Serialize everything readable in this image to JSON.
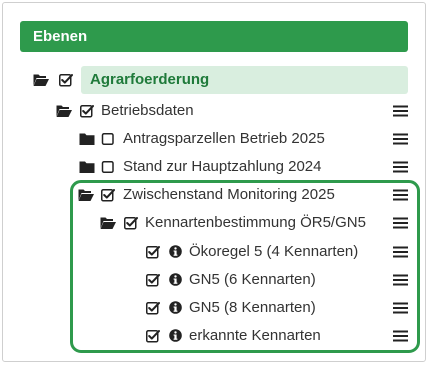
{
  "panel": {
    "title": "Ebenen"
  },
  "tree": {
    "root": {
      "label": "Agrarfoerderung"
    },
    "betriebsdaten": {
      "label": "Betriebsdaten"
    },
    "antragsparzellen": {
      "label": "Antragsparzellen Betrieb 2025"
    },
    "stand": {
      "label": "Stand zur Hauptzahlung 2024"
    },
    "zwischenstand": {
      "label": "Zwischenstand Monitoring 2025"
    },
    "kennartenbestimmung": {
      "label": "Kennartenbestimmung ÖR5/GN5"
    },
    "oekoregel5": {
      "label": "Ökoregel 5 (4 Kennarten)"
    },
    "gn5_6": {
      "label": "GN5 (6 Kennarten)"
    },
    "gn5_8": {
      "label": "GN5 (8 Kennarten)"
    },
    "erkannte": {
      "label": "erkannte Kennarten"
    }
  },
  "colors": {
    "accent": "#2e9a4c",
    "active_bg": "#d9eedf",
    "active_text": "#1f7a3a"
  }
}
